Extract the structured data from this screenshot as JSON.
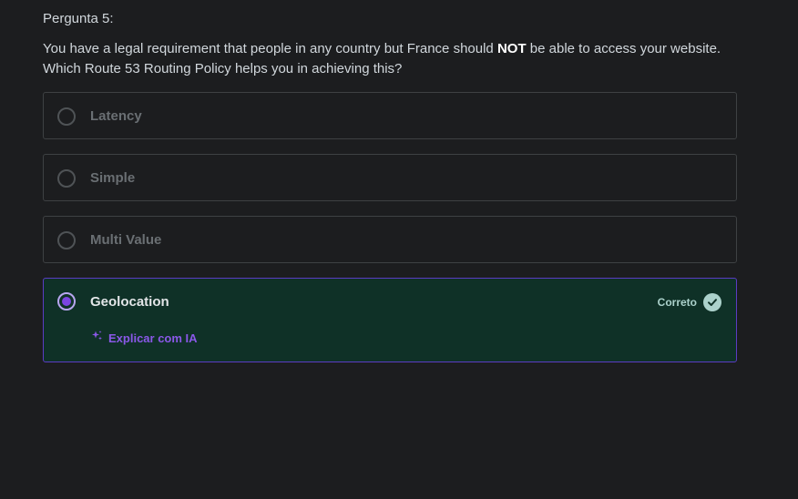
{
  "question": {
    "number_label": "Pergunta 5:",
    "text_before": "You have a legal requirement that people in any country but France should ",
    "text_emphasis": "NOT",
    "text_after": " be able to access your website. Which Route 53 Routing Policy helps you in achieving this?"
  },
  "options": [
    {
      "label": "Latency",
      "selected": false
    },
    {
      "label": "Simple",
      "selected": false
    },
    {
      "label": "Multi Value",
      "selected": false
    },
    {
      "label": "Geolocation",
      "selected": true
    }
  ],
  "result": {
    "correct_label": "Correto",
    "explain_label": "Explicar com IA"
  },
  "icons": {
    "correct": "check-circle-icon",
    "explain": "sparkle-icon"
  },
  "colors": {
    "background": "#1c1d1f",
    "correct_bg": "#0f3127",
    "accent_purple": "#8a58e8",
    "correct_green": "#acd2cc"
  }
}
